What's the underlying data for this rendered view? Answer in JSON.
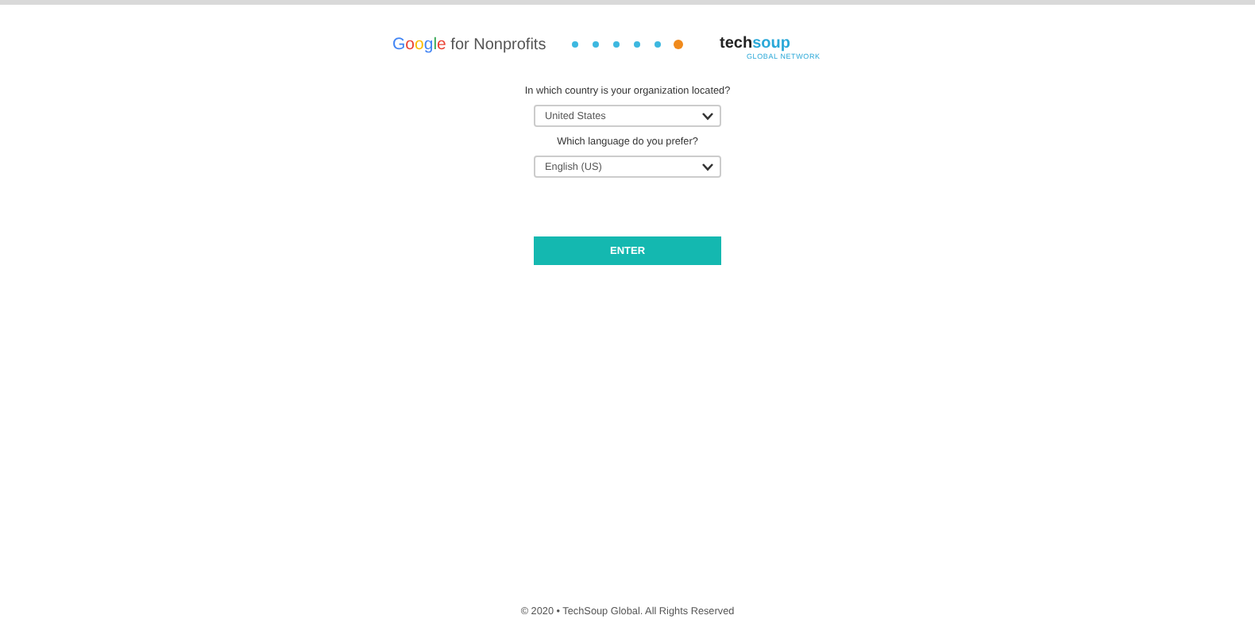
{
  "header": {
    "google_logo": {
      "brand": "Google",
      "suffix": "for Nonprofits"
    },
    "steps": [
      {
        "selected": false
      },
      {
        "selected": false
      },
      {
        "selected": false
      },
      {
        "selected": false
      },
      {
        "selected": false
      },
      {
        "selected": true
      }
    ],
    "techsoup_logo": {
      "name_left": "tech",
      "name_right": "soup",
      "tagline": "GLOBAL NETWORK"
    }
  },
  "form": {
    "fields": [
      {
        "label": "In which country is your organization located?",
        "value": "United States"
      },
      {
        "label": "Which language do you prefer?",
        "value": "English (US)"
      }
    ],
    "submit": "ENTER"
  },
  "footer": "© 2020 • TechSoup Global. All Rights Reserved"
}
